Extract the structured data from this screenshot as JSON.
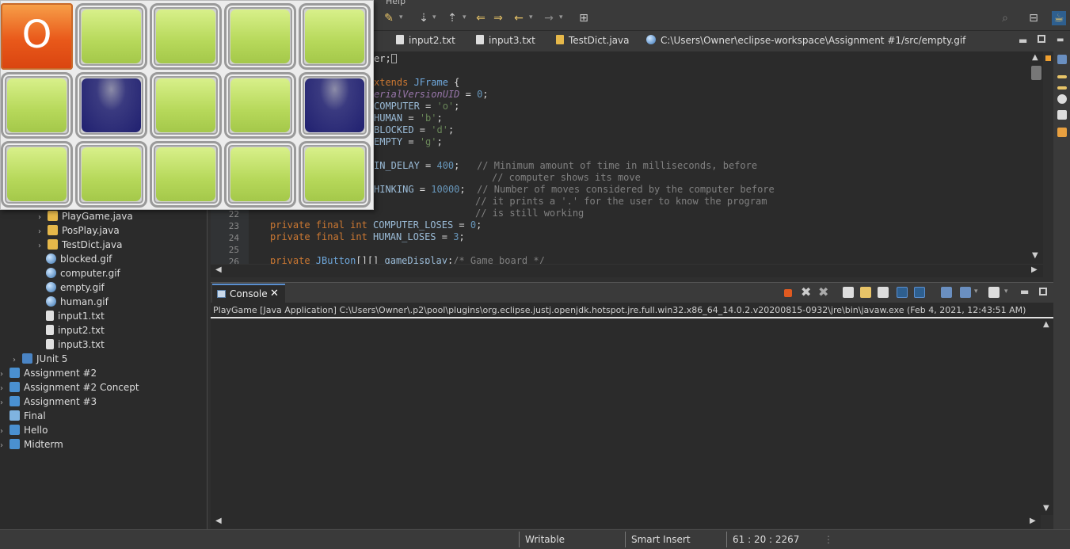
{
  "menubar": {
    "help": "Help"
  },
  "editor_tabs": [
    {
      "label": "input2.txt",
      "icon": "text-file-icon"
    },
    {
      "label": "input3.txt",
      "icon": "text-file-icon"
    },
    {
      "label": "TestDict.java",
      "icon": "java-file-icon"
    },
    {
      "label": "C:\\Users\\Owner\\eclipse-workspace\\Assignment #1/src/empty.gif",
      "icon": "gif-file-icon"
    }
  ],
  "code": {
    "line_numbers": [
      "22",
      "23",
      "24",
      "25",
      "26"
    ],
    "lines": {
      "l1": "er;",
      "l2a": "xtends ",
      "l2b": "JFrame",
      "l2c": " {",
      "l3a": "erialVersionUID",
      "l3b": " = ",
      "l3c": "0",
      "l3d": ";",
      "l4a": "COMPUTER",
      "l4b": " = ",
      "l4c": "'o'",
      "l4d": ";",
      "l5a": "HUMAN",
      "l5b": " = ",
      "l5c": "'b'",
      "l5d": ";",
      "l6a": "BLOCKED",
      "l6b": " = ",
      "l6c": "'d'",
      "l6d": ";",
      "l7a": "EMPTY",
      "l7b": " = ",
      "l7c": "'g'",
      "l7d": ";",
      "l9a": "IN_DELAY",
      "l9b": " = ",
      "l9c": "400",
      "l9d": ";   ",
      "l9e": "// Minimum amount of time in milliseconds, before",
      "l10": "// computer shows its move",
      "l11a": "HINKING",
      "l11b": " = ",
      "l11c": "10000",
      "l11d": ";  ",
      "l11e": "// Number of moves considered by the computer before",
      "l12": "// it prints a '.' for the user to know the program",
      "l13": "// is still working",
      "l14a": "private final int ",
      "l14b": "COMPUTER_LOSES",
      "l14c": " = ",
      "l14d": "0",
      "l14e": ";",
      "l15a": "private final int ",
      "l15b": "HUMAN_LOSES",
      "l15c": " = ",
      "l15d": "3",
      "l15e": ";",
      "l17a": "private ",
      "l17b": "JButton",
      "l17c": "[][] ",
      "l17d": "gameDisplay",
      "l17e": ";",
      "l17f": "/* Game board */"
    }
  },
  "tree": [
    {
      "label": "PlayGame.java",
      "type": "java",
      "chevron": true
    },
    {
      "label": "PosPlay.java",
      "type": "java",
      "chevron": true
    },
    {
      "label": "TestDict.java",
      "type": "java",
      "chevron": true
    },
    {
      "label": "blocked.gif",
      "type": "gif",
      "chevron": false
    },
    {
      "label": "computer.gif",
      "type": "gif",
      "chevron": false
    },
    {
      "label": "empty.gif",
      "type": "gif",
      "chevron": false
    },
    {
      "label": "human.gif",
      "type": "gif",
      "chevron": false
    },
    {
      "label": "input1.txt",
      "type": "txt",
      "chevron": false
    },
    {
      "label": "input2.txt",
      "type": "txt",
      "chevron": false
    },
    {
      "label": "input3.txt",
      "type": "txt",
      "chevron": false
    },
    {
      "label": "JUnit 5",
      "type": "junit",
      "chevron": true
    },
    {
      "label": "Assignment #2",
      "type": "proj",
      "chevron": true
    },
    {
      "label": "Assignment #2 Concept",
      "type": "proj",
      "chevron": true
    },
    {
      "label": "Assignment #3",
      "type": "proj",
      "chevron": true
    },
    {
      "label": "Final",
      "type": "folder",
      "chevron": false
    },
    {
      "label": "Hello",
      "type": "proj",
      "chevron": true
    },
    {
      "label": "Midterm",
      "type": "proj",
      "chevron": true
    }
  ],
  "console": {
    "tab_label": "Console",
    "description": "PlayGame [Java Application] C:\\Users\\Owner\\.p2\\pool\\plugins\\org.eclipse.justj.openjdk.hotspot.jre.full.win32.x86_64_14.0.2.v20200815-0932\\jre\\bin\\javaw.exe  (Feb 4, 2021, 12:43:51 AM)"
  },
  "status": {
    "writable": "Writable",
    "insert_mode": "Smart Insert",
    "position": "61 : 20 : 2267"
  },
  "game": {
    "board": [
      [
        "o",
        "g",
        "g",
        "g",
        "g"
      ],
      [
        "g",
        "d",
        "g",
        "g",
        "d"
      ],
      [
        "g",
        "g",
        "g",
        "g",
        "g"
      ]
    ],
    "computer_mark": "O"
  },
  "colors": {
    "computer": "#e9591a",
    "empty": "#b6d85a",
    "blocked": "#202070",
    "accent": "#5a8fd0"
  }
}
